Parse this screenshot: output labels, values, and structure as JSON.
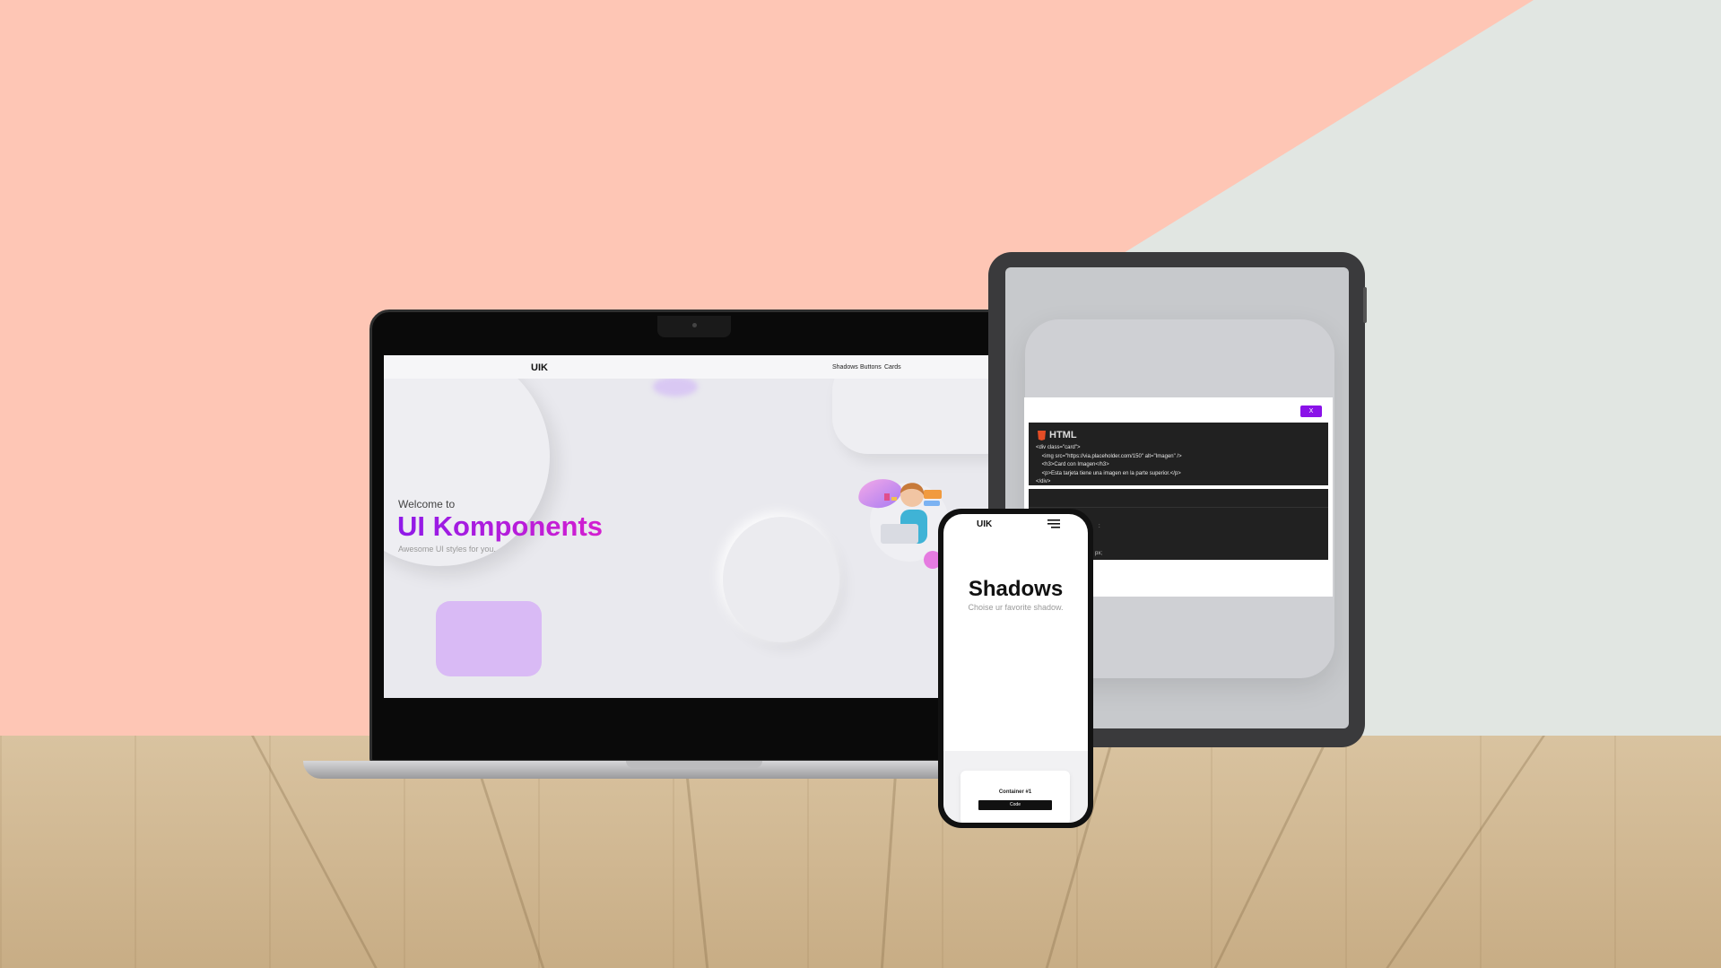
{
  "laptop": {
    "logo": "UIK",
    "nav": [
      "Shadows",
      "Buttons",
      "Cards"
    ],
    "welcome": "Welcome to",
    "title": "UI Komponents",
    "subtitle": "Awesome UI styles for you."
  },
  "tablet": {
    "close_label": "X",
    "html_title": "HTML",
    "code_lines": [
      "<div class=\"card\">",
      "    <img src=\"https://via.placeholder.com/150\" alt=\"Imagen\" />",
      "    <h3>Card con Imagen</h3>",
      "    <p>Esta tarjeta tiene una imagen en la parte superior.</p>",
      "</div>"
    ],
    "css_fragments": [
      ":",
      "px;"
    ]
  },
  "phone": {
    "logo": "UIK",
    "title": "Shadows",
    "subtitle": "Choise ur favorite shadow.",
    "card_title": "Container #1",
    "card_button": "Code"
  },
  "colors": {
    "wall": "#fec6b5",
    "wall_right": "#e1e6e2",
    "accent_purple": "#8a12e8",
    "title_gradient_start": "#8f1ae8",
    "title_gradient_end": "#d41fd0"
  }
}
